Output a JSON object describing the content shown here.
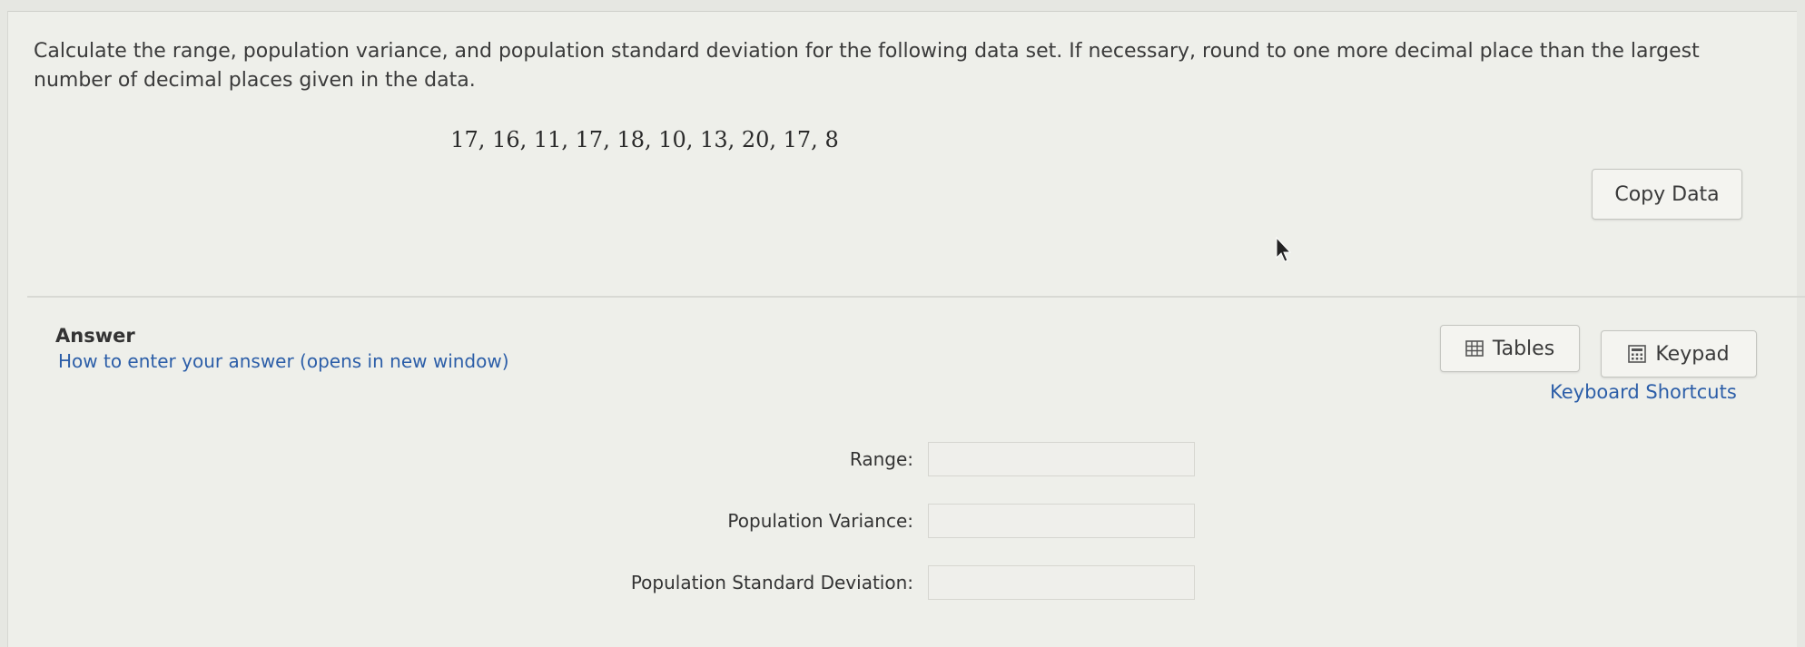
{
  "question": {
    "text": "Calculate the range, population variance, and population standard deviation for the following data set. If necessary, round to one more decimal place than the largest number of decimal places given in the data.",
    "dataset": "17, 16, 11, 17, 18, 10, 13, 20, 17, 8",
    "copy_data_label": "Copy Data"
  },
  "answer": {
    "title": "Answer",
    "howto_link": "How to enter your answer (opens in new window)",
    "tables_label": "Tables",
    "keypad_label": "Keypad",
    "keyboard_shortcuts_label": "Keyboard Shortcuts",
    "fields": [
      {
        "label": "Range:",
        "value": ""
      },
      {
        "label": "Population Variance:",
        "value": ""
      },
      {
        "label": "Population Standard Deviation:",
        "value": ""
      }
    ]
  },
  "icons": {
    "tables": "table-grid-icon",
    "keypad": "calculator-icon",
    "cursor": "mouse-pointer-icon"
  },
  "colors": {
    "link": "#2c5ea8",
    "background": "#eeefea"
  }
}
